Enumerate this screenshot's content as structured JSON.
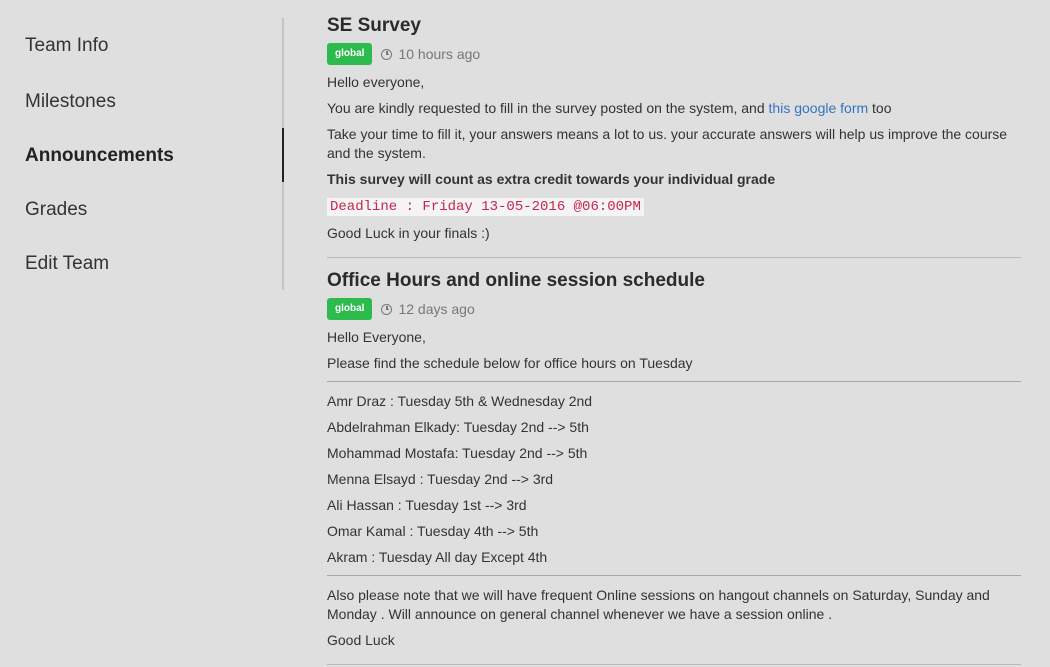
{
  "sidebar": {
    "items": [
      {
        "label": "Team Info"
      },
      {
        "label": "Milestones"
      },
      {
        "label": "Announcements"
      },
      {
        "label": "Grades"
      },
      {
        "label": "Edit Team"
      }
    ]
  },
  "posts": [
    {
      "title": "SE Survey",
      "badge": "global",
      "time": "10 hours ago",
      "greeting": "Hello everyone,",
      "line1_pre": "You are kindly requested to fill in the survey posted on the system, and ",
      "line1_link": "this google form",
      "line1_post": " too",
      "line2": "Take your time to fill it, your answers means a lot to us. your accurate answers will help us improve the course and the system.",
      "line3": "This survey will count as extra credit towards your individual grade",
      "deadline": "Deadline : Friday 13-05-2016 @06:00PM",
      "closing": "Good Luck in your finals :)"
    },
    {
      "title": "Office Hours and online session schedule",
      "badge": "global",
      "time": "12 days ago",
      "greeting": "Hello Everyone,",
      "intro": "Please find the schedule below for office hours on Tuesday",
      "schedule": [
        "Amr Draz : Tuesday 5th & Wednesday 2nd",
        "Abdelrahman Elkady: Tuesday 2nd --> 5th",
        "Mohammad Mostafa: Tuesday 2nd --> 5th",
        "Menna Elsayd : Tuesday 2nd --> 3rd",
        "Ali Hassan : Tuesday 1st --> 3rd",
        "Omar Kamal : Tuesday 4th --> 5th",
        "Akram : Tuesday All day Except 4th"
      ],
      "note": "Also please note that we will have frequent Online sessions on hangout channels on Saturday, Sunday and Monday . Will announce on general channel whenever we have a session online .",
      "closing": "Good Luck"
    }
  ],
  "colors": {
    "background": "#dfdfdf",
    "badge": "#2dbb4d",
    "link": "#3374c2",
    "code": "#c7254e"
  },
  "icons": {
    "time": "clock-icon"
  }
}
